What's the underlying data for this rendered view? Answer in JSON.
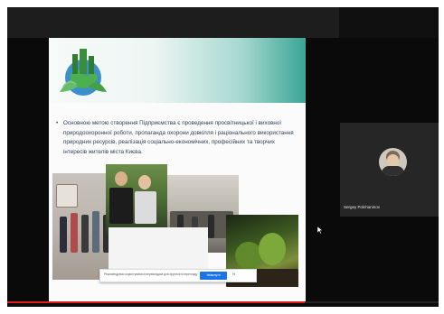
{
  "slide": {
    "bullet_text": "Основною метою створення Підприємства є проведення просвітницької і виховної природоохоронної роботи, пропаганда охорони довкілля і раціонального використання природних ресурсів, реалізація соціально-економічних, професійних та творчих інтересів жителів міста Києва."
  },
  "caption_bar": {
    "prompt_text": "Рекомендуємо користуватися перекладом для зручності перегляду",
    "primary_button": "Увімкнути",
    "secondary_link": "Ні"
  },
  "participant": {
    "name": "Sergey Polchaninov"
  },
  "colors": {
    "accent_blue": "#1a73e8",
    "progress_red": "#e21b1b",
    "slide_header_teal": "#3aa596"
  },
  "playback": {
    "progress_fraction": 0.69
  }
}
